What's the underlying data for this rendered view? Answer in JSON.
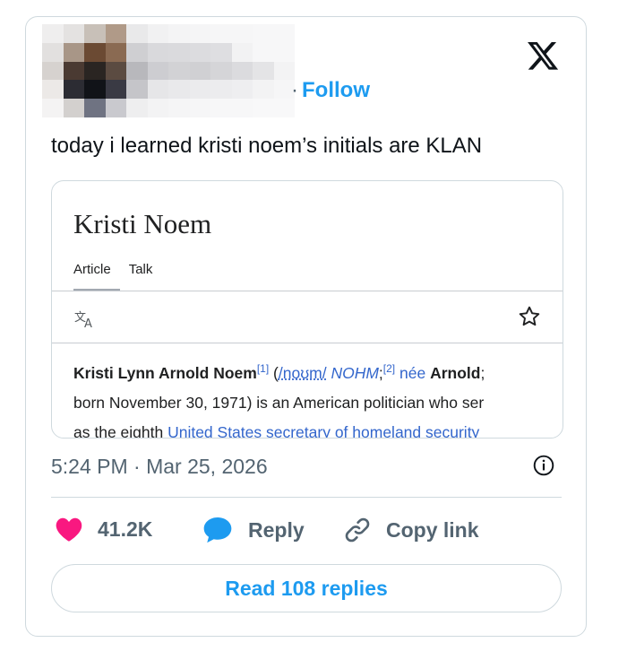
{
  "tweet": {
    "follow_label": "Follow",
    "follow_separator": "·",
    "text": "today i learned kristi noem’s initials are KLAN",
    "timestamp": "5:24 PM · Mar 25, 2026",
    "likes": "41.2K",
    "reply_label": "Reply",
    "copy_link_label": "Copy link",
    "read_replies_label": "Read 108 replies"
  },
  "embed": {
    "title": "Kristi Noem",
    "tabs": [
      "Article",
      "Talk"
    ],
    "line1": {
      "name": "Kristi Lynn Arnold Noem",
      "ref1": "[1]",
      "open": " (",
      "ipa": "/noʊm/",
      "ital": " NOHM",
      "semi": ";",
      "ref2": "[2]",
      "nee": " née",
      "arnold": "Arnold",
      "tail": ";"
    },
    "line2": "born November 30, 1971) is an American politician who ser",
    "line3_prefix": "as the eighth ",
    "line3_link": "United States secretary of homeland security"
  },
  "icons": {
    "logo": "x-logo-icon",
    "translate": "translate-icon",
    "star": "star-icon",
    "info": "info-icon",
    "heart": "heart-icon",
    "reply": "reply-bubble-icon",
    "link": "link-icon"
  },
  "colors": {
    "accent": "#1d9bf0",
    "heart": "#f91880",
    "wiki_link": "#3366cc",
    "muted": "#536471"
  }
}
